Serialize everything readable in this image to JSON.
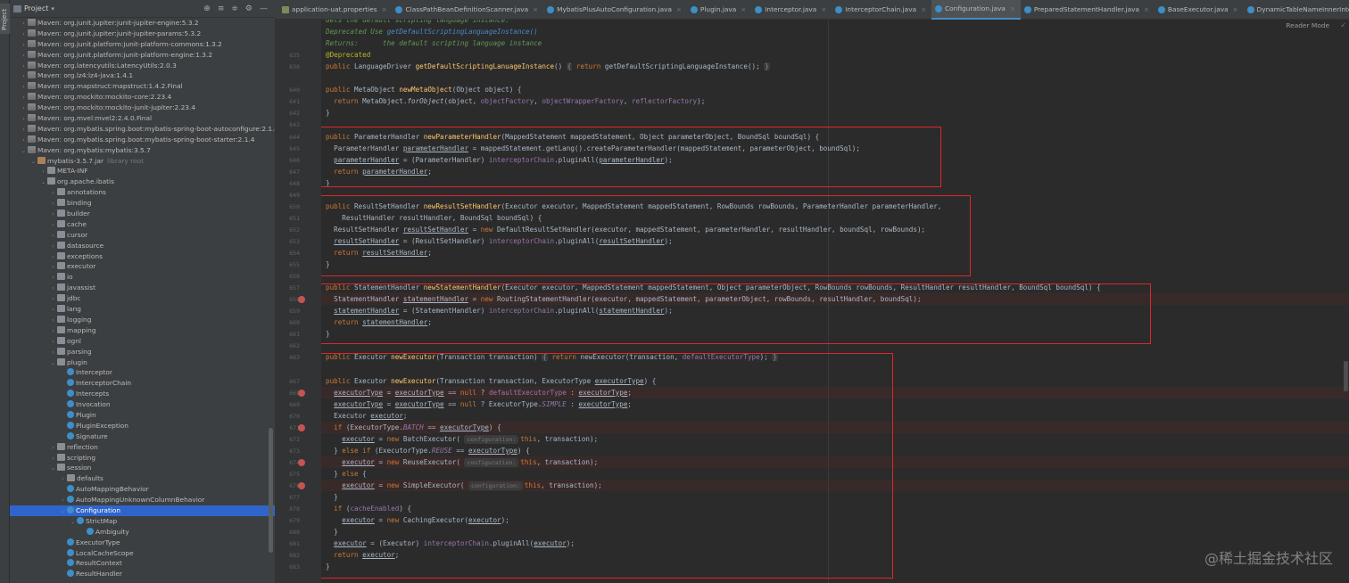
{
  "tool_strip": {
    "project_tab": "Project"
  },
  "project_panel": {
    "title": "Project",
    "tree": [
      {
        "depth": 1,
        "arrow": "›",
        "icon": "lib",
        "label": "Maven: org.junit.jupiter:junit-jupiter-engine:5.3.2"
      },
      {
        "depth": 1,
        "arrow": "›",
        "icon": "lib",
        "label": "Maven: org.junit.jupiter:junit-jupiter-params:5.3.2"
      },
      {
        "depth": 1,
        "arrow": "›",
        "icon": "lib",
        "label": "Maven: org.junit.platform:junit-platform-commons:1.3.2"
      },
      {
        "depth": 1,
        "arrow": "›",
        "icon": "lib",
        "label": "Maven: org.junit.platform:junit-platform-engine:1.3.2"
      },
      {
        "depth": 1,
        "arrow": "›",
        "icon": "lib",
        "label": "Maven: org.latencyutils:LatencyUtils:2.0.3"
      },
      {
        "depth": 1,
        "arrow": "›",
        "icon": "lib",
        "label": "Maven: org.lz4:lz4-java:1.4.1"
      },
      {
        "depth": 1,
        "arrow": "›",
        "icon": "lib",
        "label": "Maven: org.mapstruct:mapstruct:1.4.2.Final"
      },
      {
        "depth": 1,
        "arrow": "›",
        "icon": "lib",
        "label": "Maven: org.mockito:mockito-core:2.23.4"
      },
      {
        "depth": 1,
        "arrow": "›",
        "icon": "lib",
        "label": "Maven: org.mockito:mockito-junit-jupiter:2.23.4"
      },
      {
        "depth": 1,
        "arrow": "›",
        "icon": "lib",
        "label": "Maven: org.mvel:mvel2:2.4.0.Final"
      },
      {
        "depth": 1,
        "arrow": "›",
        "icon": "lib",
        "label": "Maven: org.mybatis.spring.boot:mybatis-spring-boot-autoconfigure:2.1.4"
      },
      {
        "depth": 1,
        "arrow": "›",
        "icon": "lib",
        "label": "Maven: org.mybatis.spring.boot:mybatis-spring-boot-starter:2.1.4"
      },
      {
        "depth": 1,
        "arrow": "⌄",
        "icon": "lib",
        "label": "Maven: org.mybatis:mybatis:3.5.7"
      },
      {
        "depth": 2,
        "arrow": "⌄",
        "icon": "jar",
        "label": "mybatis-3.5.7.jar",
        "extra": "library root"
      },
      {
        "depth": 3,
        "arrow": "›",
        "icon": "folder",
        "label": "META-INF"
      },
      {
        "depth": 3,
        "arrow": "⌄",
        "icon": "folder",
        "label": "org.apache.ibatis"
      },
      {
        "depth": 4,
        "arrow": "›",
        "icon": "folder",
        "label": "annotations"
      },
      {
        "depth": 4,
        "arrow": "›",
        "icon": "folder",
        "label": "binding"
      },
      {
        "depth": 4,
        "arrow": "›",
        "icon": "folder",
        "label": "builder"
      },
      {
        "depth": 4,
        "arrow": "›",
        "icon": "folder",
        "label": "cache"
      },
      {
        "depth": 4,
        "arrow": "›",
        "icon": "folder",
        "label": "cursor"
      },
      {
        "depth": 4,
        "arrow": "›",
        "icon": "folder",
        "label": "datasource"
      },
      {
        "depth": 4,
        "arrow": "›",
        "icon": "folder",
        "label": "exceptions"
      },
      {
        "depth": 4,
        "arrow": "›",
        "icon": "folder",
        "label": "executor"
      },
      {
        "depth": 4,
        "arrow": "›",
        "icon": "folder",
        "label": "io"
      },
      {
        "depth": 4,
        "arrow": "›",
        "icon": "folder",
        "label": "javassist"
      },
      {
        "depth": 4,
        "arrow": "›",
        "icon": "folder",
        "label": "jdbc"
      },
      {
        "depth": 4,
        "arrow": "›",
        "icon": "folder",
        "label": "lang"
      },
      {
        "depth": 4,
        "arrow": "›",
        "icon": "folder",
        "label": "logging"
      },
      {
        "depth": 4,
        "arrow": "›",
        "icon": "folder",
        "label": "mapping"
      },
      {
        "depth": 4,
        "arrow": "›",
        "icon": "folder",
        "label": "ognl"
      },
      {
        "depth": 4,
        "arrow": "›",
        "icon": "folder",
        "label": "parsing"
      },
      {
        "depth": 4,
        "arrow": "⌄",
        "icon": "folder",
        "label": "plugin"
      },
      {
        "depth": 5,
        "arrow": "",
        "icon": "cls",
        "label": "Interceptor"
      },
      {
        "depth": 5,
        "arrow": "",
        "icon": "cls",
        "label": "InterceptorChain"
      },
      {
        "depth": 5,
        "arrow": "",
        "icon": "cls",
        "label": "Intercepts"
      },
      {
        "depth": 5,
        "arrow": "",
        "icon": "cls",
        "label": "Invocation"
      },
      {
        "depth": 5,
        "arrow": "",
        "icon": "cls",
        "label": "Plugin"
      },
      {
        "depth": 5,
        "arrow": "",
        "icon": "cls",
        "label": "PluginException"
      },
      {
        "depth": 5,
        "arrow": "",
        "icon": "cls",
        "label": "Signature"
      },
      {
        "depth": 4,
        "arrow": "›",
        "icon": "folder",
        "label": "reflection"
      },
      {
        "depth": 4,
        "arrow": "›",
        "icon": "folder",
        "label": "scripting"
      },
      {
        "depth": 4,
        "arrow": "⌄",
        "icon": "folder",
        "label": "session"
      },
      {
        "depth": 5,
        "arrow": "›",
        "icon": "folder",
        "label": "defaults"
      },
      {
        "depth": 5,
        "arrow": "",
        "icon": "cls",
        "label": "AutoMappingBehavior"
      },
      {
        "depth": 5,
        "arrow": "›",
        "icon": "cls",
        "label": "AutoMappingUnknownColumnBehavior"
      },
      {
        "depth": 5,
        "arrow": "⌄",
        "icon": "cls",
        "label": "Configuration",
        "selected": true
      },
      {
        "depth": 6,
        "arrow": "⌄",
        "icon": "cls",
        "label": "StrictMap"
      },
      {
        "depth": 7,
        "arrow": "",
        "icon": "cls",
        "label": "Ambiguity"
      },
      {
        "depth": 5,
        "arrow": "",
        "icon": "cls",
        "label": "ExecutorType"
      },
      {
        "depth": 5,
        "arrow": "",
        "icon": "cls",
        "label": "LocalCacheScope"
      },
      {
        "depth": 5,
        "arrow": "",
        "icon": "cls",
        "label": "ResultContext"
      },
      {
        "depth": 5,
        "arrow": "",
        "icon": "cls",
        "label": "ResultHandler"
      }
    ]
  },
  "tabs": [
    {
      "label": "application-uat.properties",
      "icon": "prop"
    },
    {
      "label": "ClassPathBeanDefinitionScanner.java",
      "icon": "cls"
    },
    {
      "label": "MybatisPlusAutoConfiguration.java",
      "icon": "cls"
    },
    {
      "label": "Plugin.java",
      "icon": "cls"
    },
    {
      "label": "Interceptor.java",
      "icon": "cls"
    },
    {
      "label": "InterceptorChain.java",
      "icon": "cls"
    },
    {
      "label": "Configuration.java",
      "icon": "cls",
      "active": true
    },
    {
      "label": "PreparedStatementHandler.java",
      "icon": "cls"
    },
    {
      "label": "BaseExecutor.java",
      "icon": "cls"
    },
    {
      "label": "DynamicTableNameInnerInterceptor.java",
      "icon": "cls"
    }
  ],
  "reader_mode": "Reader Mode",
  "gutter": {
    "line_numbers": [
      "635",
      "636",
      "640",
      "641",
      "642",
      "643",
      "644",
      "645",
      "646",
      "647",
      "648",
      "649",
      "650",
      "651",
      "652",
      "653",
      "654",
      "655",
      "656",
      "657",
      "658",
      "659",
      "660",
      "661",
      "662",
      "663",
      "666",
      "667",
      "668",
      "669",
      "670",
      "671",
      "672",
      "673",
      "674",
      "675",
      "676",
      "677",
      "678",
      "679",
      "680",
      "681",
      "682",
      "683"
    ],
    "breakpoints": [
      "658",
      "668",
      "672",
      "674",
      "676"
    ]
  },
  "code_lines": [
    {
      "n": "",
      "html": "<span class=\"doc\">Gets the default scripting language instance.</span>"
    },
    {
      "n": "",
      "html": "<span class=\"doc\">Deprecated Use <span style=\"color:#4a88c7\">getDefaultScriptingLanguageInstance()</span></span>"
    },
    {
      "n": "",
      "html": "<span class=\"doc\">Returns:      the default scripting language instance</span>"
    },
    {
      "n": "635",
      "html": "<span class=\"ann\">@Deprecated</span>"
    },
    {
      "n": "636",
      "html": "<span class=\"kw\">public</span> LanguageDriver <span class=\"fn\">getDefaultScriptingLanuageInstance</span>() <span class=\"fold\">{</span> <span class=\"kw\">return</span> getDefaultScriptingLanguageInstance(); <span class=\"fold\">}</span>"
    },
    {
      "n": "",
      "html": ""
    },
    {
      "n": "640",
      "html": "<span class=\"kw\">public</span> MetaObject <span class=\"fn\">newMetaObject</span>(Object object) {"
    },
    {
      "n": "641",
      "html": "  <span class=\"kw\">return</span> MetaObject.<span class=\"it\">forObject</span>(object, <span class=\"fld\">objectFactory</span>, <span class=\"fld\">objectWrapperFactory</span>, <span class=\"fld\">reflectorFactory</span>);"
    },
    {
      "n": "642",
      "html": "}"
    },
    {
      "n": "643",
      "html": ""
    },
    {
      "n": "644",
      "html": "<span class=\"kw\">public</span> ParameterHandler <span class=\"fn\">newParameterHandler</span>(MappedStatement mappedStatement, Object parameterObject, BoundSql boundSql) {"
    },
    {
      "n": "645",
      "html": "  ParameterHandler <span class=\"var\">parameterHandler</span> = mappedStatement.getLang().createParameterHandler(mappedStatement, parameterObject, boundSql);"
    },
    {
      "n": "646",
      "html": "  <span class=\"var\">parameterHandler</span> = (ParameterHandler) <span class=\"fld\">interceptorChain</span>.pluginAll(<span class=\"var\">parameterHandler</span>);"
    },
    {
      "n": "647",
      "html": "  <span class=\"kw\">return</span> <span class=\"var\">parameterHandler</span>;"
    },
    {
      "n": "648",
      "html": "}"
    },
    {
      "n": "649",
      "html": ""
    },
    {
      "n": "650",
      "html": "<span class=\"kw\">public</span> ResultSetHandler <span class=\"fn\">newResultSetHandler</span>(Executor executor, MappedStatement mappedStatement, RowBounds rowBounds, ParameterHandler parameterHandler,"
    },
    {
      "n": "651",
      "html": "    ResultHandler resultHandler, BoundSql boundSql) {"
    },
    {
      "n": "652",
      "html": "  ResultSetHandler <span class=\"var\">resultSetHandler</span> = <span class=\"kw\">new</span> DefaultResultSetHandler(executor, mappedStatement, parameterHandler, resultHandler, boundSql, rowBounds);"
    },
    {
      "n": "653",
      "html": "  <span class=\"var\">resultSetHandler</span> = (ResultSetHandler) <span class=\"fld\">interceptorChain</span>.pluginAll(<span class=\"var\">resultSetHandler</span>);"
    },
    {
      "n": "654",
      "html": "  <span class=\"kw\">return</span> <span class=\"var\">resultSetHandler</span>;"
    },
    {
      "n": "655",
      "html": "}"
    },
    {
      "n": "656",
      "html": ""
    },
    {
      "n": "657",
      "html": "<span class=\"kw\">public</span> StatementHandler <span class=\"fn\">newStatementHandler</span>(Executor executor, MappedStatement mappedStatement, Object parameterObject, RowBounds rowBounds, ResultHandler resultHandler, BoundSql boundSql) {"
    },
    {
      "n": "658",
      "html": "  StatementHandler <span class=\"var\">statementHandler</span> = <span class=\"kw\">new</span> RoutingStatementHandler(executor, mappedStatement, parameterObject, rowBounds, resultHandler, boundSql);",
      "bp": true
    },
    {
      "n": "659",
      "html": "  <span class=\"var\">statementHandler</span> = (StatementHandler) <span class=\"fld\">interceptorChain</span>.pluginAll(<span class=\"var\">statementHandler</span>);"
    },
    {
      "n": "660",
      "html": "  <span class=\"kw\">return</span> <span class=\"var\">statementHandler</span>;"
    },
    {
      "n": "661",
      "html": "}"
    },
    {
      "n": "662",
      "html": ""
    },
    {
      "n": "663",
      "html": "<span class=\"kw\">public</span> Executor <span class=\"fn\">newExecutor</span>(Transaction transaction) <span class=\"fold\">{</span> <span class=\"kw\">return</span> newExecutor(transaction, <span class=\"fld\">defaultExecutorType</span>); <span class=\"fold\">}</span>"
    },
    {
      "n": "",
      "html": ""
    },
    {
      "n": "667",
      "html": "<span class=\"kw\">public</span> Executor <span class=\"fn\">newExecutor</span>(Transaction transaction, ExecutorType <span class=\"var\">executorType</span>) {"
    },
    {
      "n": "668",
      "html": "  <span class=\"var\">executorType</span> = <span class=\"var\">executorType</span> == <span class=\"kw\">null</span> ? <span class=\"fld\">defaultExecutorType</span> : <span class=\"var\">executorType</span>;",
      "bp": true
    },
    {
      "n": "669",
      "html": "  <span class=\"var\">executorType</span> = <span class=\"var\">executorType</span> == <span class=\"kw\">null</span> ? ExecutorType.<span class=\"st\">SIMPLE</span> : <span class=\"var\">executorType</span>;"
    },
    {
      "n": "670",
      "html": "  Executor <span class=\"var\">executor</span>;"
    },
    {
      "n": "671",
      "html": "  <span class=\"kw\">if</span> (ExecutorType.<span class=\"st\">BATCH</span> == <span class=\"var\">executorType</span>) {",
      "bp": true
    },
    {
      "n": "672",
      "html": "    <span class=\"var\">executor</span> = <span class=\"kw\">new</span> BatchExecutor( <span class=\"hint\">configuration:</span><span class=\"kw\">this</span>, transaction);"
    },
    {
      "n": "673",
      "html": "  } <span class=\"kw\">else if</span> (ExecutorType.<span class=\"st\">REUSE</span> == <span class=\"var\">executorType</span>) {"
    },
    {
      "n": "674",
      "html": "    <span class=\"var\">executor</span> = <span class=\"kw\">new</span> ReuseExecutor( <span class=\"hint\">configuration:</span><span class=\"kw\">this</span>, transaction);",
      "bp": true
    },
    {
      "n": "675",
      "html": "  } <span class=\"kw\">else</span> {"
    },
    {
      "n": "676",
      "html": "    <span class=\"var\">executor</span> = <span class=\"kw\">new</span> SimpleExecutor( <span class=\"hint\">configuration:</span><span class=\"kw\">this</span>, transaction);",
      "bp": true
    },
    {
      "n": "677",
      "html": "  }"
    },
    {
      "n": "678",
      "html": "  <span class=\"kw\">if</span> (<span class=\"fld\">cacheEnabled</span>) {"
    },
    {
      "n": "679",
      "html": "    <span class=\"var\">executor</span> = <span class=\"kw\">new</span> CachingExecutor(<span class=\"var\">executor</span>);"
    },
    {
      "n": "680",
      "html": "  }"
    },
    {
      "n": "681",
      "html": "  <span class=\"var\">executor</span> = (Executor) <span class=\"fld\">interceptorChain</span>.pluginAll(<span class=\"var\">executor</span>);"
    },
    {
      "n": "682",
      "html": "  <span class=\"kw\">return</span> <span class=\"var\">executor</span>;"
    },
    {
      "n": "683",
      "html": "}"
    }
  ],
  "watermark": "@稀土掘金技术社区",
  "watermark_sub": "@稀土掘金技术社区",
  "colors": {
    "annotation_box": "#e0262a",
    "selection": "#2f65ca",
    "keyword": "#cc7832",
    "method": "#ffc66d",
    "field": "#9876aa"
  }
}
